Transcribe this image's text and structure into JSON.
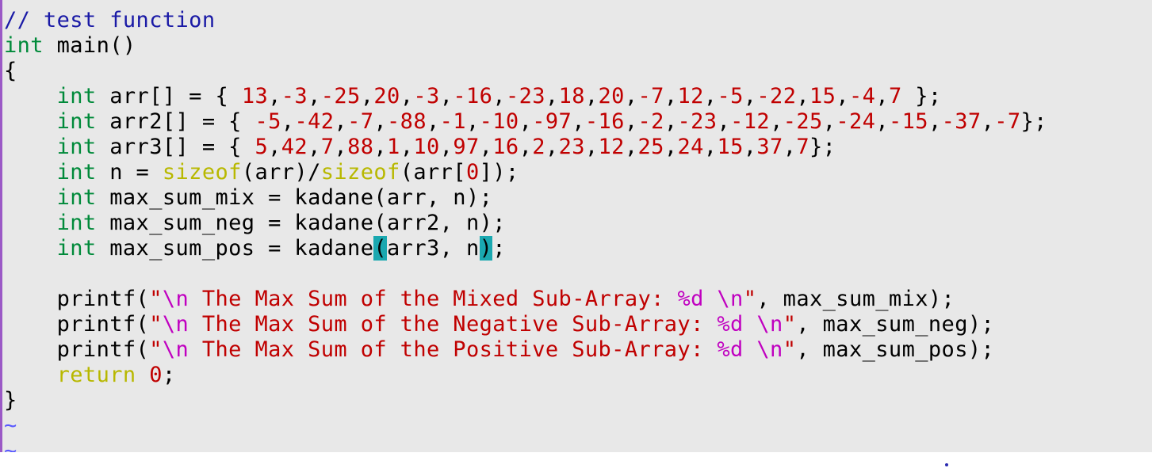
{
  "editor": {
    "lines": [
      [
        {
          "t": "// test function",
          "c": "comment"
        }
      ],
      [
        {
          "t": "int",
          "c": "type"
        },
        {
          "t": " main()",
          "c": ""
        }
      ],
      [
        {
          "t": "{",
          "c": ""
        }
      ],
      [
        {
          "t": "    ",
          "c": ""
        },
        {
          "t": "int",
          "c": "type"
        },
        {
          "t": " arr[] = { ",
          "c": ""
        },
        {
          "t": "13",
          "c": "num"
        },
        {
          "t": ",",
          "c": ""
        },
        {
          "t": "-3",
          "c": "num"
        },
        {
          "t": ",",
          "c": ""
        },
        {
          "t": "-25",
          "c": "num"
        },
        {
          "t": ",",
          "c": ""
        },
        {
          "t": "20",
          "c": "num"
        },
        {
          "t": ",",
          "c": ""
        },
        {
          "t": "-3",
          "c": "num"
        },
        {
          "t": ",",
          "c": ""
        },
        {
          "t": "-16",
          "c": "num"
        },
        {
          "t": ",",
          "c": ""
        },
        {
          "t": "-23",
          "c": "num"
        },
        {
          "t": ",",
          "c": ""
        },
        {
          "t": "18",
          "c": "num"
        },
        {
          "t": ",",
          "c": ""
        },
        {
          "t": "20",
          "c": "num"
        },
        {
          "t": ",",
          "c": ""
        },
        {
          "t": "-7",
          "c": "num"
        },
        {
          "t": ",",
          "c": ""
        },
        {
          "t": "12",
          "c": "num"
        },
        {
          "t": ",",
          "c": ""
        },
        {
          "t": "-5",
          "c": "num"
        },
        {
          "t": ",",
          "c": ""
        },
        {
          "t": "-22",
          "c": "num"
        },
        {
          "t": ",",
          "c": ""
        },
        {
          "t": "15",
          "c": "num"
        },
        {
          "t": ",",
          "c": ""
        },
        {
          "t": "-4",
          "c": "num"
        },
        {
          "t": ",",
          "c": ""
        },
        {
          "t": "7",
          "c": "num"
        },
        {
          "t": " };",
          "c": ""
        }
      ],
      [
        {
          "t": "    ",
          "c": ""
        },
        {
          "t": "int",
          "c": "type"
        },
        {
          "t": " arr2[] = { ",
          "c": ""
        },
        {
          "t": "-5",
          "c": "num"
        },
        {
          "t": ",",
          "c": ""
        },
        {
          "t": "-42",
          "c": "num"
        },
        {
          "t": ",",
          "c": ""
        },
        {
          "t": "-7",
          "c": "num"
        },
        {
          "t": ",",
          "c": ""
        },
        {
          "t": "-88",
          "c": "num"
        },
        {
          "t": ",",
          "c": ""
        },
        {
          "t": "-1",
          "c": "num"
        },
        {
          "t": ",",
          "c": ""
        },
        {
          "t": "-10",
          "c": "num"
        },
        {
          "t": ",",
          "c": ""
        },
        {
          "t": "-97",
          "c": "num"
        },
        {
          "t": ",",
          "c": ""
        },
        {
          "t": "-16",
          "c": "num"
        },
        {
          "t": ",",
          "c": ""
        },
        {
          "t": "-2",
          "c": "num"
        },
        {
          "t": ",",
          "c": ""
        },
        {
          "t": "-23",
          "c": "num"
        },
        {
          "t": ",",
          "c": ""
        },
        {
          "t": "-12",
          "c": "num"
        },
        {
          "t": ",",
          "c": ""
        },
        {
          "t": "-25",
          "c": "num"
        },
        {
          "t": ",",
          "c": ""
        },
        {
          "t": "-24",
          "c": "num"
        },
        {
          "t": ",",
          "c": ""
        },
        {
          "t": "-15",
          "c": "num"
        },
        {
          "t": ",",
          "c": ""
        },
        {
          "t": "-37",
          "c": "num"
        },
        {
          "t": ",",
          "c": ""
        },
        {
          "t": "-7",
          "c": "num"
        },
        {
          "t": "};",
          "c": ""
        }
      ],
      [
        {
          "t": "    ",
          "c": ""
        },
        {
          "t": "int",
          "c": "type"
        },
        {
          "t": " arr3[] = { ",
          "c": ""
        },
        {
          "t": "5",
          "c": "num"
        },
        {
          "t": ",",
          "c": ""
        },
        {
          "t": "42",
          "c": "num"
        },
        {
          "t": ",",
          "c": ""
        },
        {
          "t": "7",
          "c": "num"
        },
        {
          "t": ",",
          "c": ""
        },
        {
          "t": "88",
          "c": "num"
        },
        {
          "t": ",",
          "c": ""
        },
        {
          "t": "1",
          "c": "num"
        },
        {
          "t": ",",
          "c": ""
        },
        {
          "t": "10",
          "c": "num"
        },
        {
          "t": ",",
          "c": ""
        },
        {
          "t": "97",
          "c": "num"
        },
        {
          "t": ",",
          "c": ""
        },
        {
          "t": "16",
          "c": "num"
        },
        {
          "t": ",",
          "c": ""
        },
        {
          "t": "2",
          "c": "num"
        },
        {
          "t": ",",
          "c": ""
        },
        {
          "t": "23",
          "c": "num"
        },
        {
          "t": ",",
          "c": ""
        },
        {
          "t": "12",
          "c": "num"
        },
        {
          "t": ",",
          "c": ""
        },
        {
          "t": "25",
          "c": "num"
        },
        {
          "t": ",",
          "c": ""
        },
        {
          "t": "24",
          "c": "num"
        },
        {
          "t": ",",
          "c": ""
        },
        {
          "t": "15",
          "c": "num"
        },
        {
          "t": ",",
          "c": ""
        },
        {
          "t": "37",
          "c": "num"
        },
        {
          "t": ",",
          "c": ""
        },
        {
          "t": "7",
          "c": "num"
        },
        {
          "t": "};",
          "c": ""
        }
      ],
      [
        {
          "t": "    ",
          "c": ""
        },
        {
          "t": "int",
          "c": "type"
        },
        {
          "t": " n = ",
          "c": ""
        },
        {
          "t": "sizeof",
          "c": "func"
        },
        {
          "t": "(arr)/",
          "c": ""
        },
        {
          "t": "sizeof",
          "c": "func"
        },
        {
          "t": "(arr[",
          "c": ""
        },
        {
          "t": "0",
          "c": "num"
        },
        {
          "t": "]);",
          "c": ""
        }
      ],
      [
        {
          "t": "    ",
          "c": ""
        },
        {
          "t": "int",
          "c": "type"
        },
        {
          "t": " max_sum_mix = kadane(arr, n);",
          "c": ""
        }
      ],
      [
        {
          "t": "    ",
          "c": ""
        },
        {
          "t": "int",
          "c": "type"
        },
        {
          "t": " max_sum_neg = kadane(arr2, n);",
          "c": ""
        }
      ],
      [
        {
          "t": "    ",
          "c": ""
        },
        {
          "t": "int",
          "c": "type"
        },
        {
          "t": " max_sum_pos = kadane",
          "c": ""
        },
        {
          "t": "(",
          "c": "match"
        },
        {
          "t": "arr3, n",
          "c": ""
        },
        {
          "t": ")",
          "c": "match"
        },
        {
          "t": ";",
          "c": ""
        }
      ],
      [
        {
          "t": "",
          "c": ""
        }
      ],
      [
        {
          "t": "    printf(",
          "c": ""
        },
        {
          "t": "\"",
          "c": "str"
        },
        {
          "t": "\\n",
          "c": "esc"
        },
        {
          "t": " The Max Sum of the Mixed Sub-Array: ",
          "c": "str"
        },
        {
          "t": "%d",
          "c": "esc"
        },
        {
          "t": " ",
          "c": "str"
        },
        {
          "t": "\\n",
          "c": "esc"
        },
        {
          "t": "\"",
          "c": "str"
        },
        {
          "t": ", max_sum_mix);",
          "c": ""
        }
      ],
      [
        {
          "t": "    printf(",
          "c": ""
        },
        {
          "t": "\"",
          "c": "str"
        },
        {
          "t": "\\n",
          "c": "esc"
        },
        {
          "t": " The Max Sum of the Negative Sub-Array: ",
          "c": "str"
        },
        {
          "t": "%d",
          "c": "esc"
        },
        {
          "t": " ",
          "c": "str"
        },
        {
          "t": "\\n",
          "c": "esc"
        },
        {
          "t": "\"",
          "c": "str"
        },
        {
          "t": ", max_sum_neg);",
          "c": ""
        }
      ],
      [
        {
          "t": "    printf(",
          "c": ""
        },
        {
          "t": "\"",
          "c": "str"
        },
        {
          "t": "\\n",
          "c": "esc"
        },
        {
          "t": " The Max Sum of the Positive Sub-Array: ",
          "c": "str"
        },
        {
          "t": "%d",
          "c": "esc"
        },
        {
          "t": " ",
          "c": "str"
        },
        {
          "t": "\\n",
          "c": "esc"
        },
        {
          "t": "\"",
          "c": "str"
        },
        {
          "t": ", max_sum_pos);",
          "c": ""
        }
      ],
      [
        {
          "t": "    ",
          "c": ""
        },
        {
          "t": "return",
          "c": "kw"
        },
        {
          "t": " ",
          "c": ""
        },
        {
          "t": "0",
          "c": "num"
        },
        {
          "t": ";",
          "c": ""
        }
      ],
      [
        {
          "t": "}",
          "c": ""
        }
      ],
      [
        {
          "t": "~",
          "c": "tilde"
        }
      ],
      [
        {
          "t": "~",
          "c": "tilde"
        }
      ]
    ]
  },
  "colors": {
    "background": "#e8e8e8",
    "comment": "#1a1aa6",
    "type": "#008a3a",
    "number": "#c00000",
    "builtin": "#b8b800",
    "string": "#c00000",
    "escape": "#c000c0",
    "bracket_match": "#1aa8b0",
    "tilde": "#5a5aff"
  }
}
